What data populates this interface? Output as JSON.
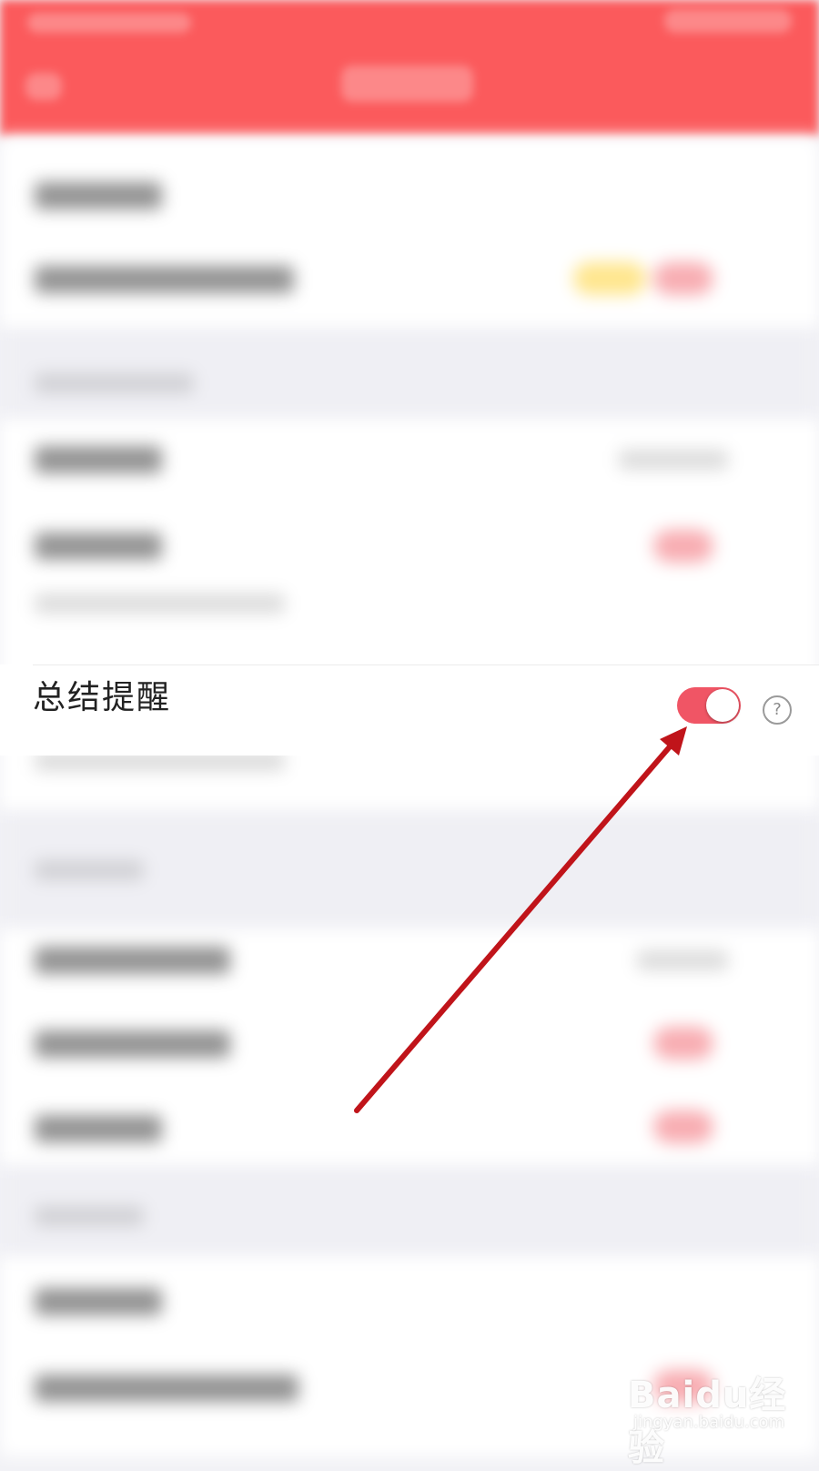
{
  "setting_row": {
    "label": "总结提醒",
    "toggle_on": true,
    "help_glyph": "?"
  },
  "colors": {
    "header": "#fb5a5c",
    "toggle_on": "#f05565",
    "annotation_arrow": "#c0141a"
  },
  "watermark": {
    "text": "Baidu经验",
    "url": "jingyan.baidu.com"
  }
}
